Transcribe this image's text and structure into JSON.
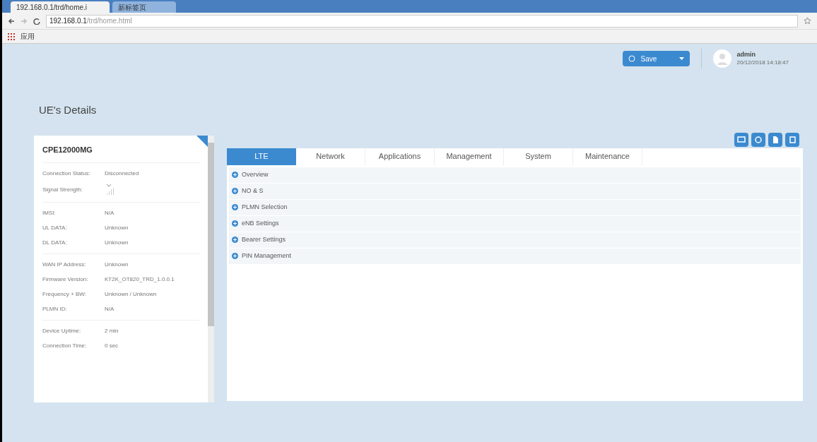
{
  "browser": {
    "tabs": [
      {
        "title": "192.168.0.1/trd/home.i",
        "selected": true
      },
      {
        "title": "新标签页",
        "selected": false
      }
    ],
    "url_host": "192.168.0.1",
    "url_path": "/trd/home.html",
    "bookmarks": [
      "应用"
    ]
  },
  "header": {
    "save_button": "Save",
    "user": "admin",
    "datetime": "20/12/2018 14:18:47"
  },
  "page_title": "UE's Details",
  "device": {
    "name": "CPE12000MG",
    "groups": [
      [
        {
          "label": "Connection Status:",
          "value": "Disconnected",
          "kind": "text"
        },
        {
          "label": "Signal Strength:",
          "kind": "signal"
        }
      ],
      [
        {
          "label": "IMSI:",
          "value": "N/A",
          "kind": "text"
        },
        {
          "label": "UL DATA:",
          "value": "Unknown",
          "kind": "text"
        },
        {
          "label": "DL DATA:",
          "value": "Unknown",
          "kind": "text"
        }
      ],
      [
        {
          "label": "WAN IP Address:",
          "value": "Unknown",
          "kind": "text"
        },
        {
          "label": "Firmware Version:",
          "value": "KT2K_OT820_TRD_1.0.0.1",
          "kind": "text"
        },
        {
          "label": "Frequency + BW:",
          "value": "Unknown / Unknown",
          "kind": "text"
        },
        {
          "label": "PLMN ID:",
          "value": "N/A",
          "kind": "text"
        }
      ],
      [
        {
          "label": "Device Uptime:",
          "value": "2 min",
          "kind": "text"
        },
        {
          "label": "Connection Time:",
          "value": "0 sec",
          "kind": "text"
        }
      ]
    ]
  },
  "tabs": [
    {
      "label": "LTE",
      "selected": true
    },
    {
      "label": "Network",
      "selected": false
    },
    {
      "label": "Applications",
      "selected": false
    },
    {
      "label": "Management",
      "selected": false
    },
    {
      "label": "System",
      "selected": false
    },
    {
      "label": "Maintenance",
      "selected": false
    }
  ],
  "sections": [
    {
      "label": "Overview"
    },
    {
      "label": "NO & S"
    },
    {
      "label": "PLMN Selection"
    },
    {
      "label": "eNB Settings"
    },
    {
      "label": "Bearer Settings"
    },
    {
      "label": "PIN Management"
    }
  ]
}
